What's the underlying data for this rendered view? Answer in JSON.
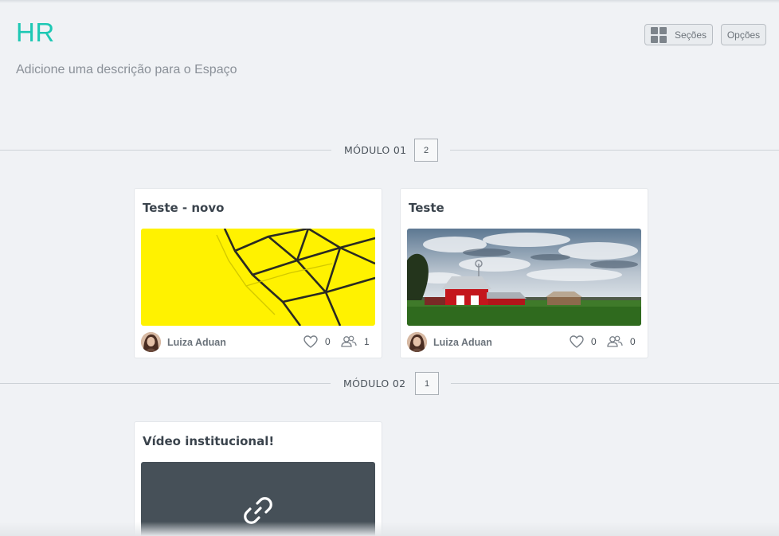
{
  "space": {
    "title": "HR",
    "description": "Adicione uma descrição para o Espaço"
  },
  "toolbar": {
    "sections_label": "Seções",
    "options_label": "Opções"
  },
  "modules": [
    {
      "label": "MÓDULO 01",
      "count": "2",
      "cards": [
        {
          "title": "Teste - novo",
          "author": "Luiza Aduan",
          "likes": "0",
          "members": "1",
          "media": "abstract-yellow-image"
        },
        {
          "title": "Teste",
          "author": "Luiza Aduan",
          "likes": "0",
          "members": "0",
          "media": "red-barn-landscape-image"
        }
      ]
    },
    {
      "label": "MÓDULO 02",
      "count": "1",
      "cards": [
        {
          "title": "Vídeo institucional!",
          "media": "link-icon"
        }
      ]
    }
  ],
  "colors": {
    "accent": "#1ec8b4",
    "background": "#f0f2f5",
    "video_placeholder": "#465058"
  }
}
